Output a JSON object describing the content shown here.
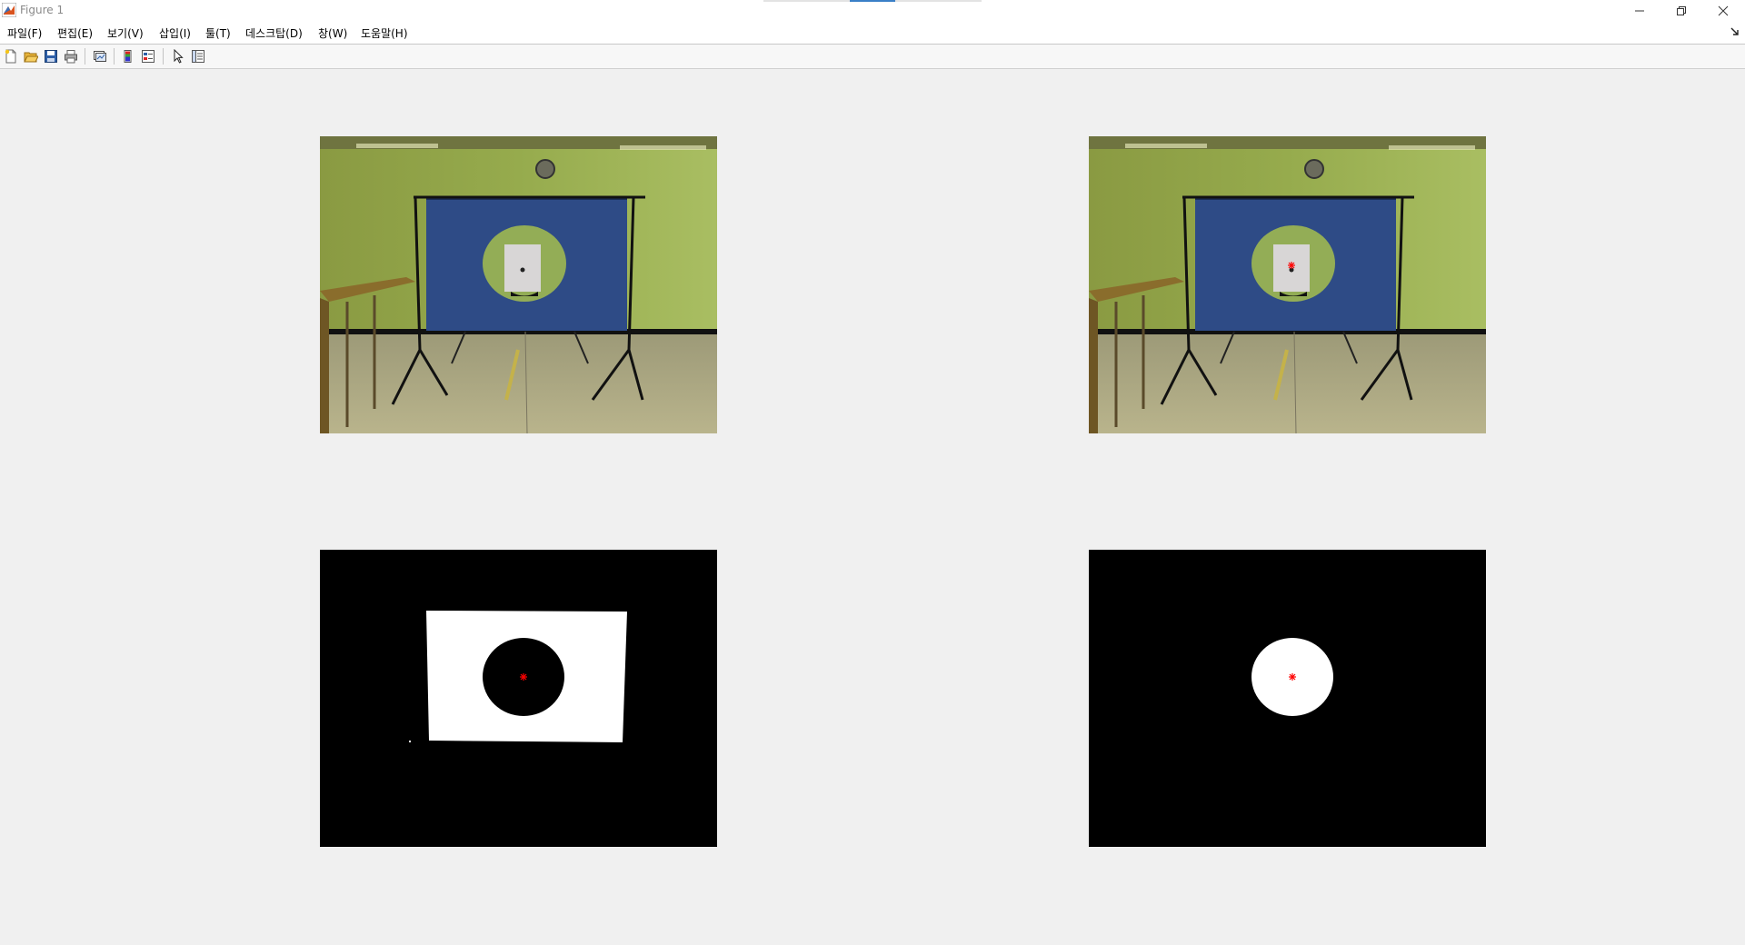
{
  "window": {
    "title": "Figure 1",
    "controls": [
      "minimize",
      "restore",
      "close"
    ]
  },
  "menubar": {
    "items": [
      {
        "label": "파일(F)"
      },
      {
        "label": "편집(E)"
      },
      {
        "label": "보기(V)"
      },
      {
        "label": "삽입(I)"
      },
      {
        "label": "툴(T)"
      },
      {
        "label": "데스크탑(D)"
      },
      {
        "label": "창(W)"
      },
      {
        "label": "도움말(H)"
      }
    ]
  },
  "toolbar": {
    "buttons": [
      {
        "name": "new-figure-icon"
      },
      {
        "name": "open-file-icon"
      },
      {
        "name": "save-icon"
      },
      {
        "name": "print-icon"
      },
      {
        "name": "link-plot-icon"
      },
      {
        "name": "insert-colorbar-icon"
      },
      {
        "name": "insert-legend-icon"
      },
      {
        "name": "edit-plot-arrow-icon"
      },
      {
        "name": "property-inspector-icon"
      }
    ]
  },
  "figure": {
    "background_color": "#f0f0f0",
    "marker_color": "#ff0000",
    "panels": [
      {
        "name": "original-photo-axes",
        "content": "photo",
        "marker": false
      },
      {
        "name": "photo-with-center-marker-axes",
        "content": "photo",
        "marker": true
      },
      {
        "name": "binary-mask-target-axes",
        "content": "mask-rect-hole",
        "marker": true
      },
      {
        "name": "binary-mask-circle-axes",
        "content": "mask-circle",
        "marker": true
      }
    ]
  }
}
